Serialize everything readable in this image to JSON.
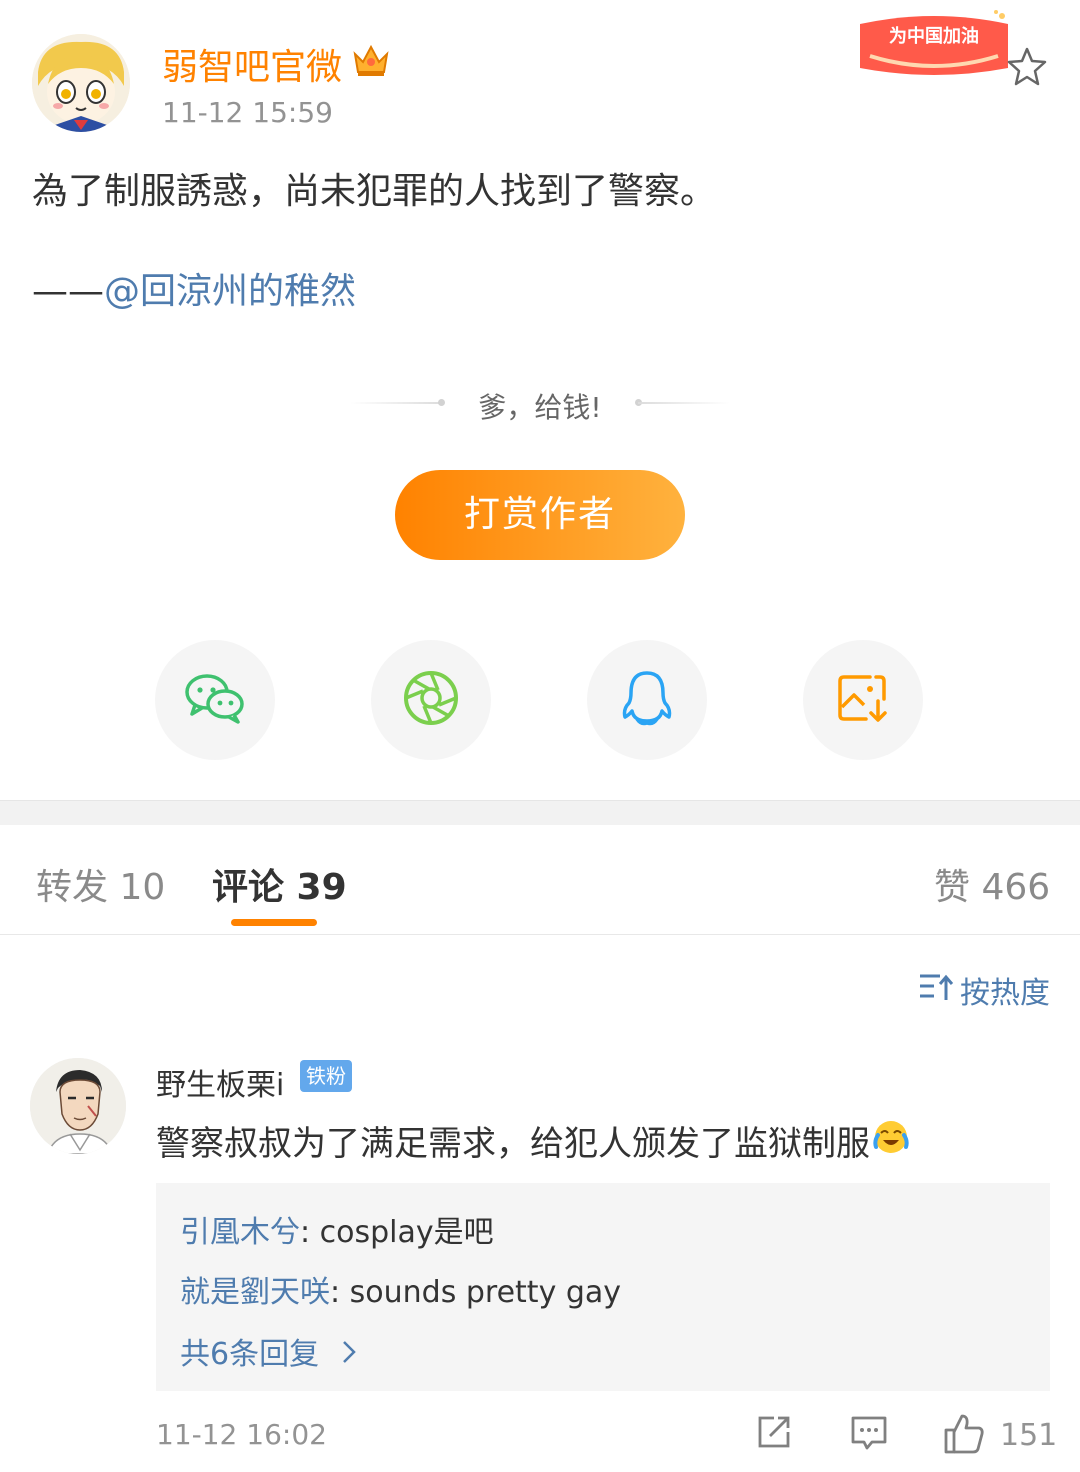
{
  "post": {
    "author": "弱智吧官微",
    "time": "11-12 15:59",
    "badge_text": "为中国加油",
    "text": "為了制服誘惑，尚未犯罪的人找到了警察。",
    "credit_dash": "——",
    "credit_link": "@回涼州的稚然"
  },
  "reward": {
    "caption": "爹，给钱!",
    "button_label": "打赏作者"
  },
  "share": {
    "icons": [
      "wechat-icon",
      "moments-icon",
      "qq-icon",
      "save-image-icon"
    ]
  },
  "tabs": {
    "repost": "转发 10",
    "comments": "评论 39",
    "likes": "赞 466"
  },
  "sort_label": "按热度",
  "comment": {
    "user": "野生板栗i",
    "badge": "铁粉",
    "text": "警察叔叔为了满足需求，给犯人颁发了监狱制服",
    "emoji": "crying-laughing-emoji",
    "replies": [
      {
        "name": "引凰木兮",
        "text": ": cosplay是吧"
      },
      {
        "name": "就是劉天咲",
        "text": ": sounds pretty gay"
      }
    ],
    "more_replies": "共6条回复",
    "time": "11-12 16:02",
    "like_count": "151"
  },
  "colors": {
    "accent": "#ff8200",
    "link": "#4f7cae",
    "muted": "#939393"
  }
}
